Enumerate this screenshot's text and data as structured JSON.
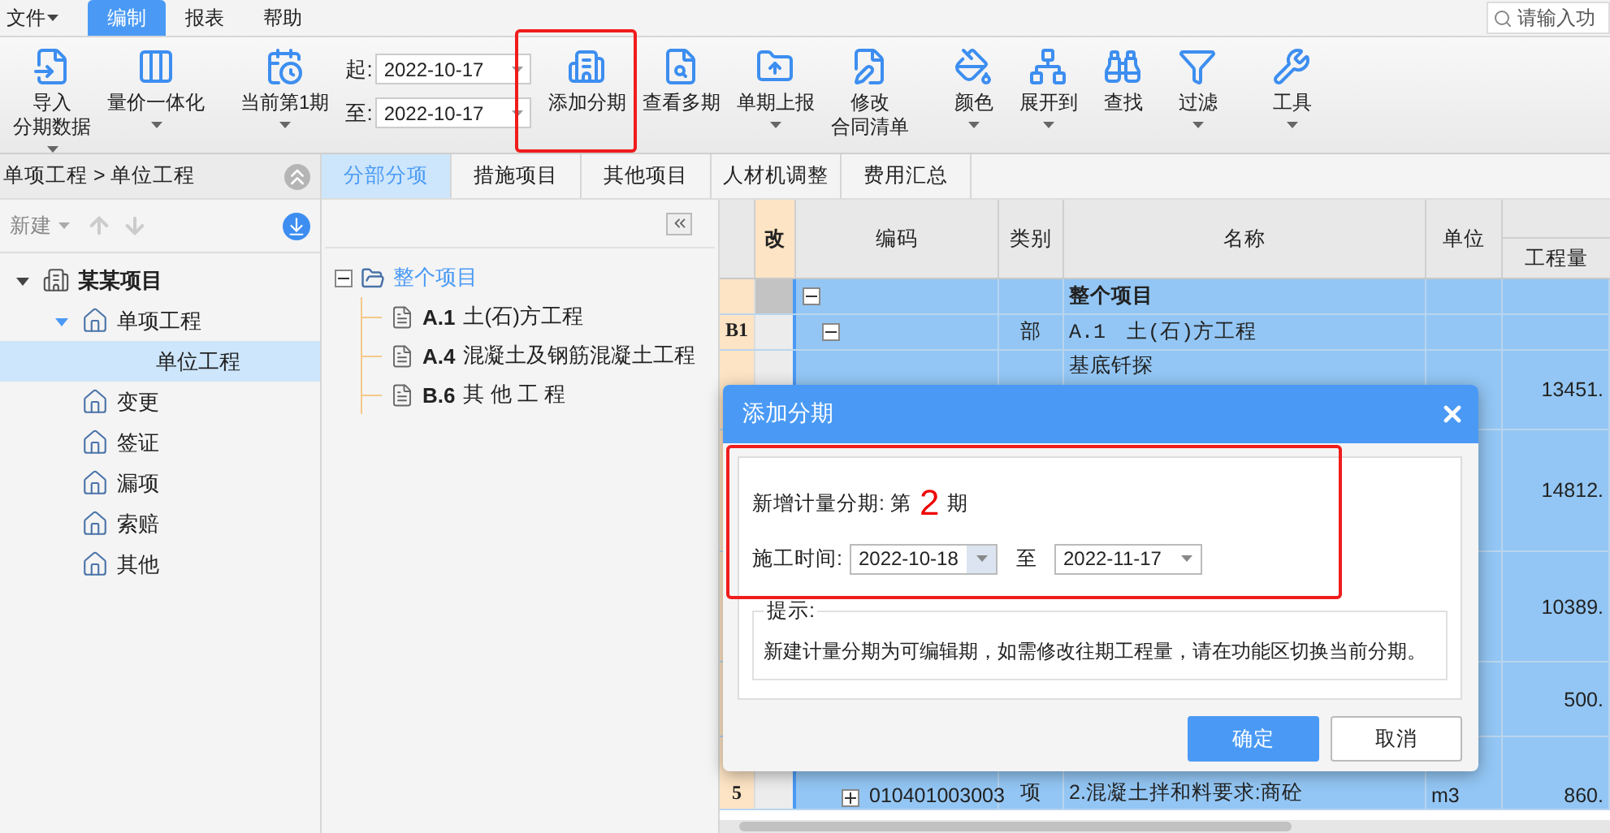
{
  "menu": [
    {
      "label": "文件",
      "selected": false,
      "has_menu": true
    },
    {
      "label": "编制",
      "selected": true,
      "has_menu": false
    },
    {
      "label": "报表",
      "selected": false,
      "has_menu": false
    },
    {
      "label": "帮助",
      "selected": false,
      "has_menu": false
    }
  ],
  "search": {
    "placeholder": "请输入功"
  },
  "ribbon": [
    [
      {
        "kind": "button",
        "lines": [
          "导入",
          "分期数据"
        ],
        "has_menu": true
      },
      {
        "kind": "button",
        "lines": [
          "量价一体化"
        ],
        "has_menu": true
      }
    ],
    [
      {
        "kind": "button",
        "lines": [
          "当前第1期"
        ],
        "has_menu": true
      },
      {
        "kind": "dates",
        "fields": [
          {
            "label": "起:",
            "value": "2022-10-17"
          },
          {
            "label": "至:",
            "value": "2022-10-17"
          }
        ]
      },
      {
        "kind": "button",
        "lines": [
          "添加分期"
        ],
        "has_menu": false
      },
      {
        "kind": "button",
        "lines": [
          "查看多期"
        ],
        "has_menu": false
      },
      {
        "kind": "button",
        "lines": [
          "单期上报"
        ],
        "has_menu": true
      },
      {
        "kind": "button",
        "lines": [
          "修改",
          "合同清单"
        ],
        "has_menu": false
      }
    ],
    [
      {
        "kind": "button",
        "lines": [
          "颜色"
        ],
        "has_menu": true
      },
      {
        "kind": "button",
        "lines": [
          "展开到"
        ],
        "has_menu": true
      },
      {
        "kind": "button",
        "lines": [
          "查找"
        ],
        "has_menu": false
      },
      {
        "kind": "button",
        "lines": [
          "过滤"
        ],
        "has_menu": true
      }
    ],
    [
      {
        "kind": "button",
        "lines": [
          "工具"
        ],
        "has_menu": true
      }
    ]
  ],
  "left_panel": {
    "breadcrumb": "单项工程 > 单位工程",
    "new_button": "新建",
    "tree": [
      {
        "label": "某某项目",
        "kind": "project",
        "expanded": true,
        "selected": false,
        "children": [
          {
            "label": "单项工程",
            "kind": "item",
            "expanded": true,
            "selected": false,
            "children": [
              {
                "label": "单位工程",
                "kind": "leaf",
                "selected": true
              }
            ]
          },
          {
            "label": "变更",
            "kind": "item",
            "selected": false
          },
          {
            "label": "签证",
            "kind": "item",
            "selected": false
          },
          {
            "label": "漏项",
            "kind": "item",
            "selected": false
          },
          {
            "label": "索赔",
            "kind": "item",
            "selected": false
          },
          {
            "label": "其他",
            "kind": "item",
            "selected": false
          }
        ]
      }
    ]
  },
  "tabs": [
    {
      "label": "分部分项",
      "selected": true
    },
    {
      "label": "措施项目",
      "selected": false
    },
    {
      "label": "其他项目",
      "selected": false
    },
    {
      "label": "人材机调整",
      "selected": false
    },
    {
      "label": "费用汇总",
      "selected": false
    }
  ],
  "outline": {
    "root": {
      "label": "整个项目",
      "expanded": true,
      "selected": true
    },
    "children": [
      {
        "code": "A.1",
        "name": "土(石)方工程"
      },
      {
        "code": "A.4",
        "name": "混凝土及钢筋混凝土工程"
      },
      {
        "code": "B.6",
        "name": "其 他 工 程"
      }
    ]
  },
  "grid": {
    "columns": [
      "改",
      "编码",
      "类别",
      "名称",
      "单位"
    ],
    "quantity_column": "工程量",
    "rows": [
      {
        "number": "",
        "kind": "project",
        "expanded": true,
        "code": "",
        "type": "",
        "name": "整个项目",
        "unit": "",
        "quantity": "",
        "selected": true
      },
      {
        "number": "B1",
        "kind": "section",
        "expanded": true,
        "code": "",
        "type": "部",
        "name": "A.1　土(石)方工程",
        "unit": "",
        "quantity": "",
        "selected": true
      },
      {
        "number": "",
        "kind": "item",
        "code": "",
        "type": "",
        "name": "基底钎探",
        "unit": "",
        "quantity": "13451.",
        "selected": true
      },
      {
        "number": "",
        "kind": "item",
        "code": "",
        "type": "",
        "name": "",
        "unit": "",
        "quantity": "14812.",
        "selected": true
      },
      {
        "number": "",
        "kind": "item",
        "code": "",
        "type": "",
        "name": "",
        "unit": "",
        "quantity": "10389.",
        "selected": true
      },
      {
        "number": "",
        "kind": "item",
        "code": "",
        "type": "",
        "name": "",
        "unit": "",
        "quantity": "500.",
        "selected": true
      },
      {
        "number": "5",
        "kind": "item",
        "expanded": false,
        "code": "010401003003",
        "type": "项",
        "name": "2.混凝土拌和料要求:商砼",
        "unit": "m3",
        "quantity": "860.",
        "selected": true
      }
    ]
  },
  "dialog": {
    "title": "添加分期",
    "period_prefix": "新增计量分期: 第",
    "period_number": "2",
    "period_suffix": "期",
    "time_label": "施工时间:",
    "start_date": "2022-10-18",
    "separator": "至",
    "end_date": "2022-11-17",
    "hint_title": "提示:",
    "hint_text": "新建计量分期为可编辑期，如需修改往期工程量，请在功能区切换当前分期。",
    "buttons": [
      {
        "label": "确定",
        "primary": true
      },
      {
        "label": "取消",
        "primary": false
      }
    ]
  }
}
